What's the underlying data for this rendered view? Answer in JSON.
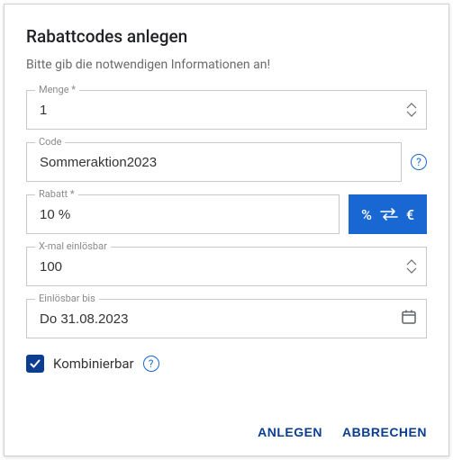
{
  "title": "Rabattcodes anlegen",
  "subtitle": "Bitte gib die notwendigen Informationen an!",
  "fields": {
    "menge": {
      "label": "Menge *",
      "value": "1"
    },
    "code": {
      "label": "Code",
      "value": "Sommeraktion2023"
    },
    "rabatt": {
      "label": "Rabatt *",
      "value": "10 %"
    },
    "xmal": {
      "label": "X-mal einlösbar",
      "value": "100"
    },
    "einloesbar": {
      "label": "Einlösbar bis",
      "value": "Do 31.08.2023"
    }
  },
  "toggle": {
    "left": "%",
    "right": "€"
  },
  "checkbox": {
    "label": "Kombinierbar",
    "checked": true
  },
  "actions": {
    "submit": "ANLEGEN",
    "cancel": "ABBRECHEN"
  }
}
